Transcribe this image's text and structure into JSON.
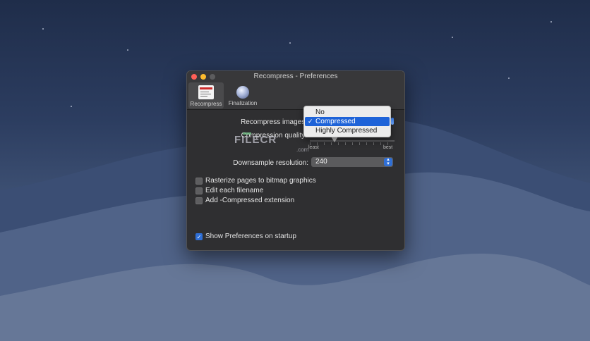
{
  "window": {
    "title": "Recompress - Preferences"
  },
  "tabs": [
    {
      "label": "Recompress",
      "icon": "pdf-recompress-icon"
    },
    {
      "label": "Finalization",
      "icon": "globe-icon"
    }
  ],
  "recompress_images": {
    "label": "Recompress images:"
  },
  "compression_quality": {
    "label": "Compression quality:",
    "tick_least": "least",
    "tick_best": "best",
    "value_fraction": 0.3
  },
  "downsample": {
    "label": "Downsample resolution:",
    "value": "240"
  },
  "checkboxes": [
    {
      "label": "Rasterize pages to bitmap graphics",
      "checked": false
    },
    {
      "label": "Edit each filename",
      "checked": false
    },
    {
      "label": "Add -Compressed extension",
      "checked": false
    },
    {
      "label": "Show Preferences on startup",
      "checked": true
    }
  ],
  "popup": {
    "options": [
      "No",
      "Compressed",
      "Highly Compressed"
    ],
    "selected": "Compressed",
    "check_glyph": "✓"
  },
  "watermark": {
    "text": "FILECR",
    "sub": ".com"
  },
  "colors": {
    "accent": "#1e63d8",
    "window_bg": "#2f2f31"
  }
}
